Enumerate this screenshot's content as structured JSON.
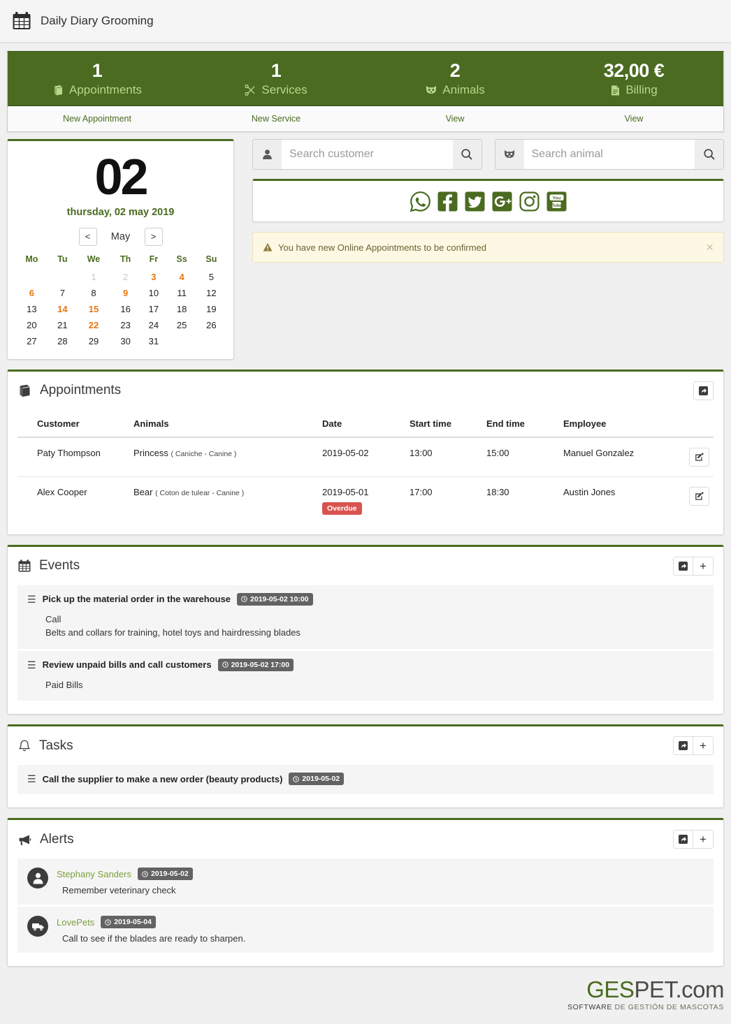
{
  "header": {
    "title": "Daily Diary Grooming",
    "icon": "calendar-icon"
  },
  "stats": {
    "items": [
      {
        "value": "1",
        "label": "Appointments",
        "icon": "book-icon",
        "link": "New Appointment"
      },
      {
        "value": "1",
        "label": "Services",
        "icon": "scissors-icon",
        "link": "New Service"
      },
      {
        "value": "2",
        "label": "Animals",
        "icon": "cat-icon",
        "link": "View"
      },
      {
        "value": "32,00 €",
        "label": "Billing",
        "icon": "invoice-icon",
        "link": "View"
      }
    ]
  },
  "calendar": {
    "day_number": "02",
    "date_line": "thursday, 02 may 2019",
    "prev_label": "<",
    "next_label": ">",
    "month": "May",
    "weekdays": [
      "Mo",
      "Tu",
      "We",
      "Th",
      "Fr",
      "Ss",
      "Su"
    ],
    "weeks": [
      [
        {
          "d": "",
          "s": "empty"
        },
        {
          "d": "",
          "s": "empty"
        },
        {
          "d": "1",
          "s": "muted"
        },
        {
          "d": "2",
          "s": "muted"
        },
        {
          "d": "3",
          "s": "hl"
        },
        {
          "d": "4",
          "s": "hl"
        },
        {
          "d": "5",
          "s": ""
        }
      ],
      [
        {
          "d": "6",
          "s": "hl"
        },
        {
          "d": "7",
          "s": ""
        },
        {
          "d": "8",
          "s": ""
        },
        {
          "d": "9",
          "s": "hl"
        },
        {
          "d": "10",
          "s": ""
        },
        {
          "d": "11",
          "s": ""
        },
        {
          "d": "12",
          "s": ""
        }
      ],
      [
        {
          "d": "13",
          "s": ""
        },
        {
          "d": "14",
          "s": "hl"
        },
        {
          "d": "15",
          "s": "hl"
        },
        {
          "d": "16",
          "s": ""
        },
        {
          "d": "17",
          "s": ""
        },
        {
          "d": "18",
          "s": ""
        },
        {
          "d": "19",
          "s": ""
        }
      ],
      [
        {
          "d": "20",
          "s": ""
        },
        {
          "d": "21",
          "s": ""
        },
        {
          "d": "22",
          "s": "hl"
        },
        {
          "d": "23",
          "s": ""
        },
        {
          "d": "24",
          "s": ""
        },
        {
          "d": "25",
          "s": ""
        },
        {
          "d": "26",
          "s": ""
        }
      ],
      [
        {
          "d": "27",
          "s": ""
        },
        {
          "d": "28",
          "s": ""
        },
        {
          "d": "29",
          "s": ""
        },
        {
          "d": "30",
          "s": ""
        },
        {
          "d": "31",
          "s": ""
        },
        {
          "d": "",
          "s": "empty"
        },
        {
          "d": "",
          "s": "empty"
        }
      ]
    ]
  },
  "search": {
    "customer_placeholder": "Search customer",
    "customer_value": "",
    "animal_placeholder": "Search animal",
    "animal_value": ""
  },
  "social": {
    "items": [
      {
        "name": "whatsapp-icon"
      },
      {
        "name": "facebook-icon"
      },
      {
        "name": "twitter-icon"
      },
      {
        "name": "googleplus-icon"
      },
      {
        "name": "instagram-icon"
      },
      {
        "name": "youtube-icon"
      }
    ]
  },
  "notice": {
    "text": "You have new Online Appointments to be confirmed",
    "close": "×"
  },
  "appointments": {
    "title": "Appointments",
    "columns": [
      "Customer",
      "Animals",
      "Date",
      "Start time",
      "End time",
      "Employee"
    ],
    "rows": [
      {
        "customer": "Paty Thompson",
        "animal": "Princess",
        "breed": "( Caniche - Canine )",
        "date": "2019-05-02",
        "badge": "",
        "start": "13:00",
        "end": "15:00",
        "employee": "Manuel Gonzalez"
      },
      {
        "customer": "Alex Cooper",
        "animal": "Bear",
        "breed": "( Coton de tulear - Canine )",
        "date": "2019-05-01",
        "badge": "Overdue",
        "start": "17:00",
        "end": "18:30",
        "employee": "Austin Jones"
      }
    ]
  },
  "events": {
    "title": "Events",
    "items": [
      {
        "title": "Pick up the material order in the warehouse",
        "chip": "2019-05-02 10:00",
        "line1": "Call",
        "line2": "Belts and collars for training, hotel toys and hairdressing blades"
      },
      {
        "title": "Review unpaid bills and call customers",
        "chip": "2019-05-02 17:00",
        "line1": "Paid Bills",
        "line2": ""
      }
    ]
  },
  "tasks": {
    "title": "Tasks",
    "items": [
      {
        "title": "Call the supplier to make a new order (beauty products)",
        "chip": "2019-05-02",
        "line1": "",
        "line2": ""
      }
    ]
  },
  "alerts": {
    "title": "Alerts",
    "items": [
      {
        "avatar": "person-icon",
        "name": "Stephany Sanders",
        "chip": "2019-05-02",
        "text": "Remember veterinary check"
      },
      {
        "avatar": "truck-icon",
        "name": "LovePets",
        "chip": "2019-05-04",
        "text": "Call to see if the blades are ready to sharpen."
      }
    ]
  },
  "footer": {
    "logo_part1": "GES",
    "logo_part2": "PET.com",
    "tagline_a": "SOFTWARE ",
    "tagline_b": "DE GESTIÓN DE MASCOTAS"
  },
  "colors": {
    "green": "#4a6b20",
    "light_green": "#b6d98b",
    "orange": "#e8760f",
    "red": "#d9534f",
    "chip_gray": "#636363",
    "notice_bg": "#fcf8e3"
  }
}
